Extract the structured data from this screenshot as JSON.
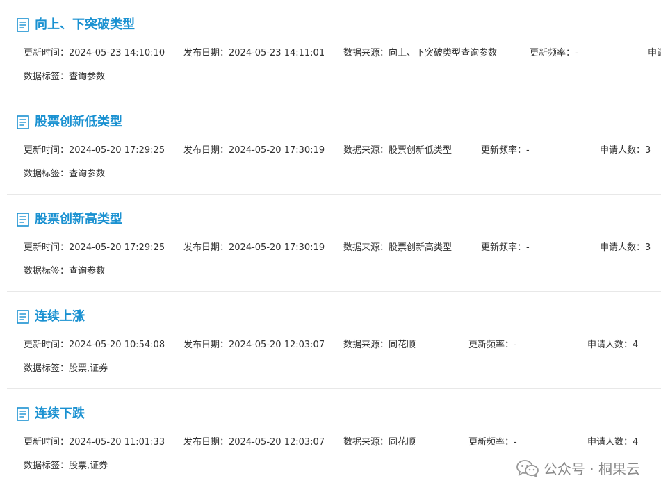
{
  "items": [
    {
      "title": "向上、下突破类型",
      "update_label": "更新时间：",
      "update_time": "2024-05-23 14:10:10",
      "publish_label": "发布日期：",
      "publish_date": "2024-05-23 14:11:01",
      "source_label": "数据来源：",
      "source": "向上、下突破类型查询参数",
      "freq_label": "更新频率：",
      "freq": "-",
      "apply_label": "申请",
      "apply_count": "",
      "tags_label": "数据标签：",
      "tags": "查询参数"
    },
    {
      "title": "股票创新低类型",
      "update_label": "更新时间：",
      "update_time": "2024-05-20 17:29:25",
      "publish_label": "发布日期：",
      "publish_date": "2024-05-20 17:30:19",
      "source_label": "数据来源：",
      "source": "股票创新低类型",
      "freq_label": "更新频率：",
      "freq": "-",
      "apply_label": "申请人数：",
      "apply_count": "3",
      "tags_label": "数据标签：",
      "tags": "查询参数"
    },
    {
      "title": "股票创新高类型",
      "update_label": "更新时间：",
      "update_time": "2024-05-20 17:29:25",
      "publish_label": "发布日期：",
      "publish_date": "2024-05-20 17:30:19",
      "source_label": "数据来源：",
      "source": "股票创新高类型",
      "freq_label": "更新频率：",
      "freq": "-",
      "apply_label": "申请人数：",
      "apply_count": "3",
      "tags_label": "数据标签：",
      "tags": "查询参数"
    },
    {
      "title": "连续上涨",
      "update_label": "更新时间：",
      "update_time": "2024-05-20 10:54:08",
      "publish_label": "发布日期：",
      "publish_date": "2024-05-20 12:03:07",
      "source_label": "数据来源：",
      "source": "同花顺",
      "freq_label": "更新频率：",
      "freq": "-",
      "apply_label": "申请人数：",
      "apply_count": "4",
      "tags_label": "数据标签：",
      "tags": "股票,证券"
    },
    {
      "title": "连续下跌",
      "update_label": "更新时间：",
      "update_time": "2024-05-20 11:01:33",
      "publish_label": "发布日期：",
      "publish_date": "2024-05-20 12:03:07",
      "source_label": "数据来源：",
      "source": "同花顺",
      "freq_label": "更新频率：",
      "freq": "-",
      "apply_label": "申请人数：",
      "apply_count": "4",
      "tags_label": "数据标签：",
      "tags": "股票,证券"
    }
  ],
  "watermark": {
    "text": "公众号 · 桐果云",
    "icon": "wechat-icon"
  },
  "colors": {
    "title": "#1a91d1",
    "text": "#333333",
    "divider": "#e8e8e8",
    "watermark": "#888888"
  }
}
